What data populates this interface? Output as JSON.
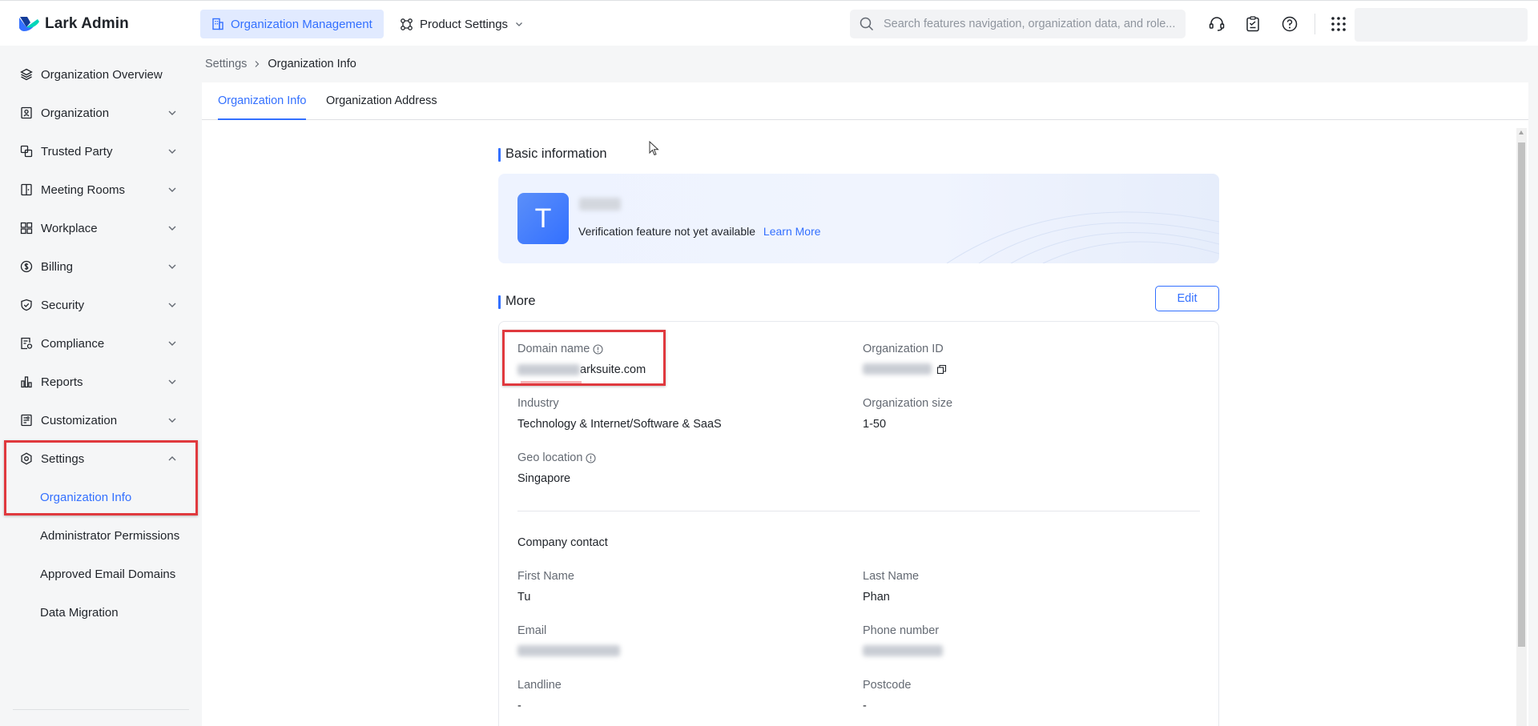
{
  "app": {
    "title": "Lark Admin"
  },
  "topnav": {
    "org_management": "Organization Management",
    "product_settings": "Product Settings",
    "search_placeholder": "Search features navigation, organization data, and role..."
  },
  "sidebar": {
    "items": [
      {
        "label": "Organization Overview",
        "icon": "layers-icon"
      },
      {
        "label": "Organization",
        "icon": "org-card-icon"
      },
      {
        "label": "Trusted Party",
        "icon": "link-icon"
      },
      {
        "label": "Meeting Rooms",
        "icon": "room-icon"
      },
      {
        "label": "Workplace",
        "icon": "grid-icon"
      },
      {
        "label": "Billing",
        "icon": "dollar-icon"
      },
      {
        "label": "Security",
        "icon": "shield-icon"
      },
      {
        "label": "Compliance",
        "icon": "compliance-icon"
      },
      {
        "label": "Reports",
        "icon": "bar-chart-icon"
      },
      {
        "label": "Customization",
        "icon": "customization-icon"
      },
      {
        "label": "Settings",
        "icon": "settings-icon"
      }
    ],
    "settings_children": [
      "Organization Info",
      "Administrator Permissions",
      "Approved Email Domains",
      "Data Migration"
    ]
  },
  "breadcrumb": {
    "parent": "Settings",
    "current": "Organization Info"
  },
  "tabs": [
    "Organization Info",
    "Organization Address"
  ],
  "basic": {
    "title": "Basic information",
    "avatar_letter": "T",
    "verification_text": "Verification feature not yet available",
    "learn_more": "Learn More"
  },
  "more": {
    "title": "More",
    "edit": "Edit",
    "domain_label": "Domain name",
    "domain_value_suffix": "arksuite.com",
    "org_id_label": "Organization ID",
    "industry_label": "Industry",
    "industry_value": "Technology & Internet/Software & SaaS",
    "org_size_label": "Organization size",
    "org_size_value": "1-50",
    "geo_label": "Geo location",
    "geo_value": "Singapore",
    "contact_title": "Company contact",
    "first_name_label": "First Name",
    "first_name_value": "Tu",
    "last_name_label": "Last Name",
    "last_name_value": "Phan",
    "email_label": "Email",
    "phone_label": "Phone number",
    "landline_label": "Landline",
    "landline_value": "-",
    "postcode_label": "Postcode",
    "postcode_value": "-"
  },
  "colors": {
    "accent": "#3370ff",
    "highlight": "#e0393e",
    "sidebar_bg": "#f5f6f7"
  }
}
